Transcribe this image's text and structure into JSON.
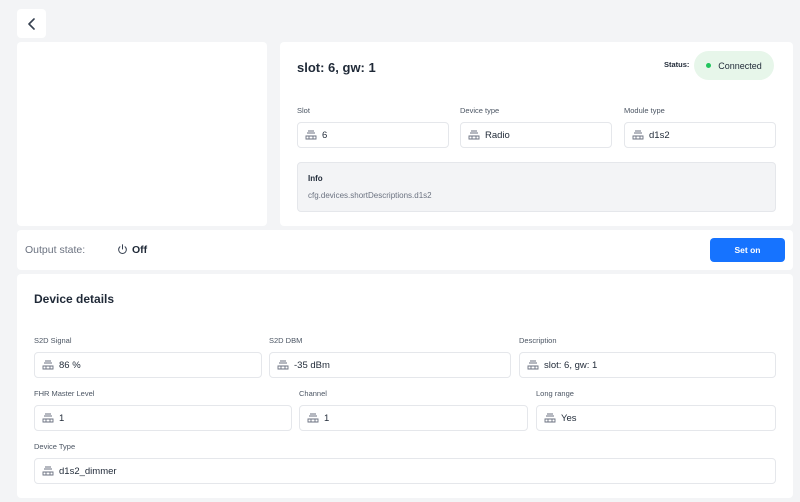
{
  "header": {
    "back_icon": "chevron-left-icon"
  },
  "device": {
    "title": "slot: 6, gw: 1",
    "status_label": "Status:",
    "status_value": "Connected",
    "status_color": "#22c55e",
    "fields": {
      "slot": {
        "label": "Slot",
        "value": "6"
      },
      "device_type": {
        "label": "Device type",
        "value": "Radio"
      },
      "module_type": {
        "label": "Module type",
        "value": "d1s2"
      }
    },
    "info": {
      "title": "Info",
      "text": "cfg.devices.shortDescriptions.d1s2"
    }
  },
  "output": {
    "label": "Output state:",
    "value": "Off",
    "button_label": "Set on",
    "accent": "#1673ff"
  },
  "details": {
    "title": "Device details",
    "s2d_signal": {
      "label": "S2D Signal",
      "value": "86 %"
    },
    "s2d_dbm": {
      "label": "S2D DBM",
      "value": "-35 dBm"
    },
    "description": {
      "label": "Description",
      "value": "slot: 6, gw: 1"
    },
    "fhr_master_level": {
      "label": "FHR Master Level",
      "value": "1"
    },
    "channel": {
      "label": "Channel",
      "value": "1"
    },
    "long_range": {
      "label": "Long range",
      "value": "Yes"
    },
    "device_type": {
      "label": "Device Type",
      "value": "d1s2_dimmer"
    }
  }
}
